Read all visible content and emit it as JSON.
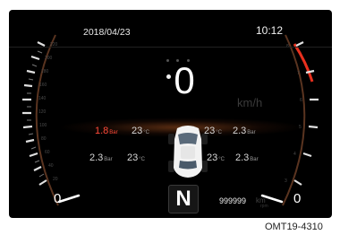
{
  "status": {
    "date": "2018/04/23",
    "time": "10:12"
  },
  "page_dots": {
    "count": 4,
    "active_index": 3
  },
  "speedometer": {
    "value": "0",
    "unit": "km/h",
    "needle_value": "0"
  },
  "tachometer": {
    "needle_value": "0"
  },
  "tires": {
    "front_left": {
      "pressure": "1.8",
      "pressure_unit": "Bar",
      "temp": "23",
      "temp_unit": "°C",
      "warning": true
    },
    "front_right": {
      "pressure": "2.3",
      "pressure_unit": "Bar",
      "temp": "23",
      "temp_unit": "°C",
      "warning": false
    },
    "rear_left": {
      "pressure": "2.3",
      "pressure_unit": "Bar",
      "temp": "23",
      "temp_unit": "°C",
      "warning": false
    },
    "rear_right": {
      "pressure": "2.3",
      "pressure_unit": "Bar",
      "temp": "23",
      "temp_unit": "°C",
      "warning": false
    }
  },
  "gear": "N",
  "odometer": {
    "value": "999999",
    "unit": "km"
  },
  "caption": "OMT19-4310",
  "colors": {
    "warning": "#ff4a3a",
    "accent_glow": "#c86428",
    "tach_redline": "#e8301e"
  }
}
